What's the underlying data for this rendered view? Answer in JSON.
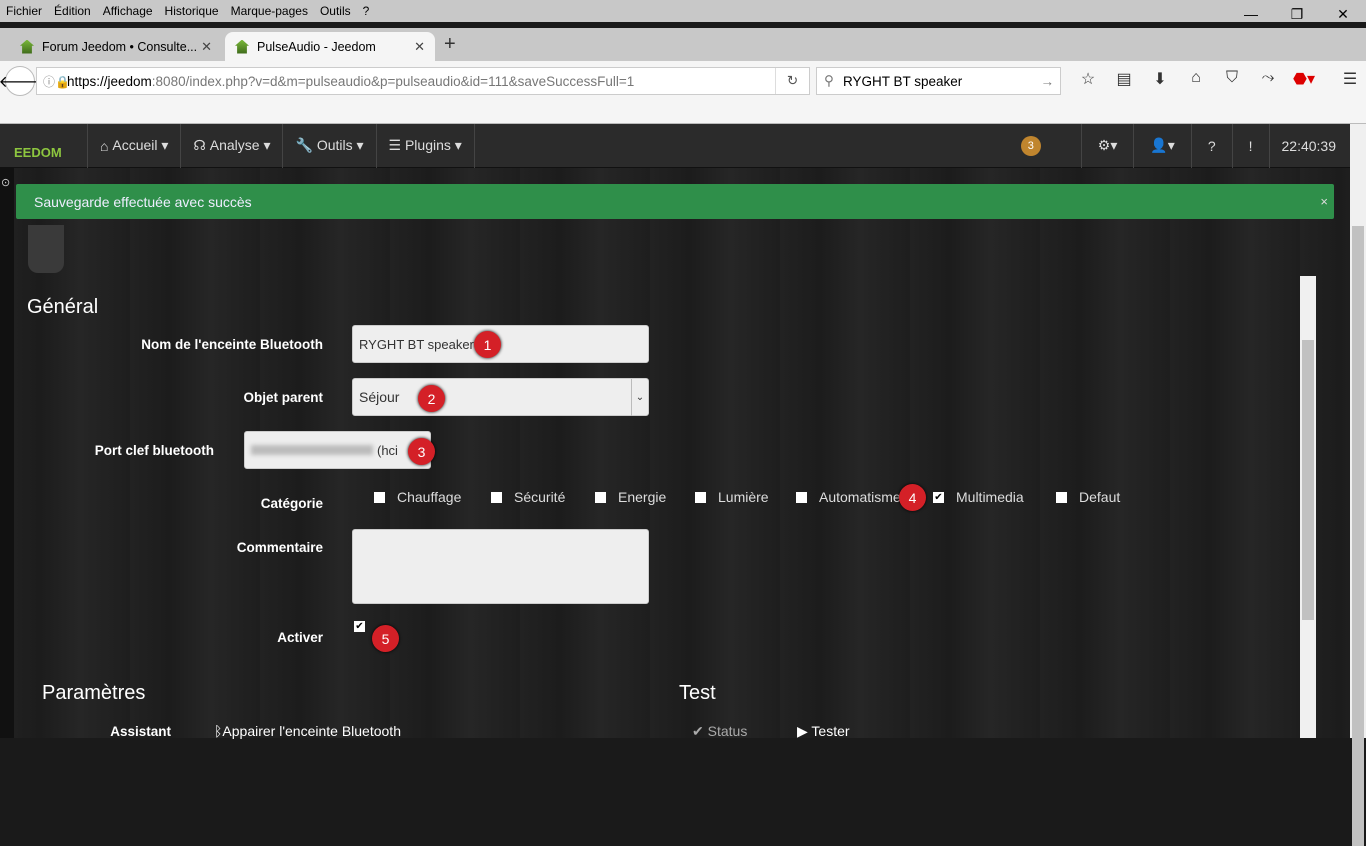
{
  "browser": {
    "menu": [
      "Fichier",
      "Édition",
      "Affichage",
      "Historique",
      "Marque-pages",
      "Outils",
      "?"
    ],
    "tabs": [
      {
        "title": "Forum Jeedom • Consulte..."
      },
      {
        "title": "PulseAudio - Jeedom"
      }
    ],
    "url_host": "https://jeedom",
    "url_rest": ":8080/index.php?v=d&m=pulseaudio&p=pulseaudio&id=111&saveSuccessFull=1",
    "search": "RYGHT BT speaker"
  },
  "nav": {
    "logo": "EEDOM",
    "items": [
      "Accueil ▾",
      "Analyse ▾",
      "Outils ▾",
      "Plugins ▾"
    ],
    "badge": "3",
    "clock": "22:40:39"
  },
  "alert": {
    "message": "Sauvegarde effectuée avec succès",
    "close": "×"
  },
  "form": {
    "section": "Général",
    "name_label": "Nom de l'enceinte Bluetooth",
    "name_value": "RYGHT BT speaker",
    "parent_label": "Objet parent",
    "parent_value": "Séjour",
    "port_label": "Port clef bluetooth",
    "port_value_visible": "(hci",
    "category_label": "Catégorie",
    "categories": [
      {
        "label": "Chauffage",
        "checked": false
      },
      {
        "label": "Sécurité",
        "checked": false
      },
      {
        "label": "Energie",
        "checked": false
      },
      {
        "label": "Lumière",
        "checked": false
      },
      {
        "label": "Automatisme",
        "checked": false
      },
      {
        "label": "Multimedia",
        "checked": true
      },
      {
        "label": "Defaut",
        "checked": false
      }
    ],
    "comment_label": "Commentaire",
    "comment_value": "",
    "active_label": "Activer",
    "active_checked": true
  },
  "callouts": [
    "1",
    "2",
    "3",
    "4",
    "5"
  ],
  "params": {
    "title": "Paramètres",
    "assistant_label": "Assistant",
    "assistant_link": "Appairer l'enceinte Bluetooth"
  },
  "test": {
    "title": "Test",
    "status_label": "Status",
    "tester": "Tester"
  },
  "colors": {
    "success": "#2f8f4a",
    "callout": "#d42027",
    "badge": "#c0852e",
    "logo": "#8dc63f"
  }
}
